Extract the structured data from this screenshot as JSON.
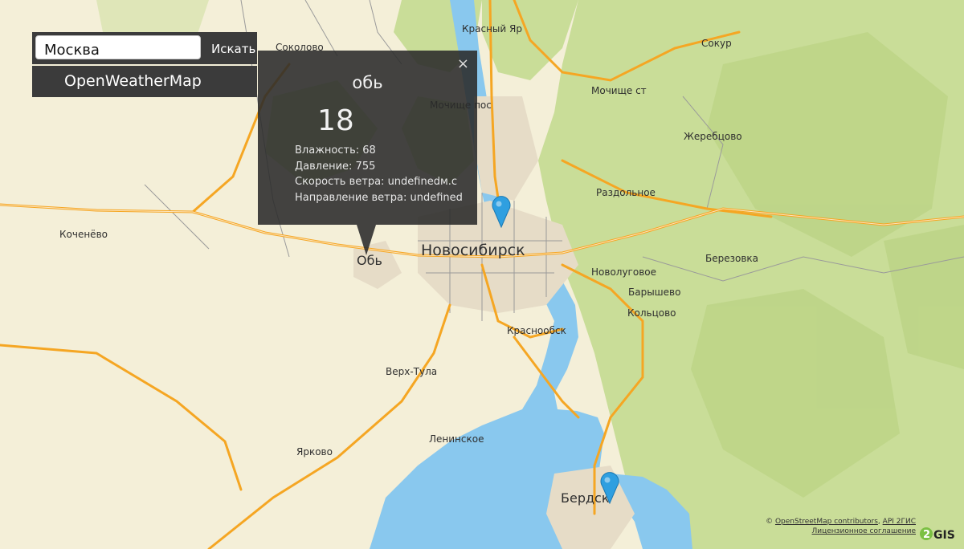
{
  "search": {
    "value": "Москва",
    "button_label": "Искать"
  },
  "provider_label": "OpenWeatherMap",
  "popup": {
    "city": "обь",
    "temperature": "18",
    "humidity": "Влажность: 68",
    "pressure": "Давление: 755",
    "wind_speed": "Скорость ветра: undefinedм.с",
    "wind_direction": "Направление ветра: undefined",
    "close_glyph": "×"
  },
  "map_labels": {
    "novosibirsk": "Новосибирск",
    "ob": "Обь",
    "berdsk": "Бердск",
    "krasny_yar": "Красный Яр",
    "sokolovo": "Соколово",
    "sokur": "Сокур",
    "mochishche_st": "Мочище ст",
    "mochishche_pos": "Мочище пос",
    "zherebtsovo": "Жеребцово",
    "razdolnoe": "Раздольное",
    "kochenevo": "Коченёво",
    "berezovka": "Березовка",
    "novolugovoe": "Новолуговое",
    "baryshevo": "Барышево",
    "koltsovo": "Кольцово",
    "krasnoobsk": "Краснообск",
    "verkh_tula": "Верх-Тула",
    "leninskoe": "Ленинское",
    "yarkovo": "Ярково"
  },
  "attribution": {
    "copyright": "©",
    "osm": "OpenStreetMap contributors",
    "api": "API 2ГИС",
    "license": "Лицензионное соглашение",
    "logo": "2GIS"
  },
  "colors": {
    "water": "#89c8ee",
    "forest": "#c7dc97",
    "road": "#f5a623",
    "panel": "#3b3b3b",
    "marker": "#2f9fe0"
  }
}
